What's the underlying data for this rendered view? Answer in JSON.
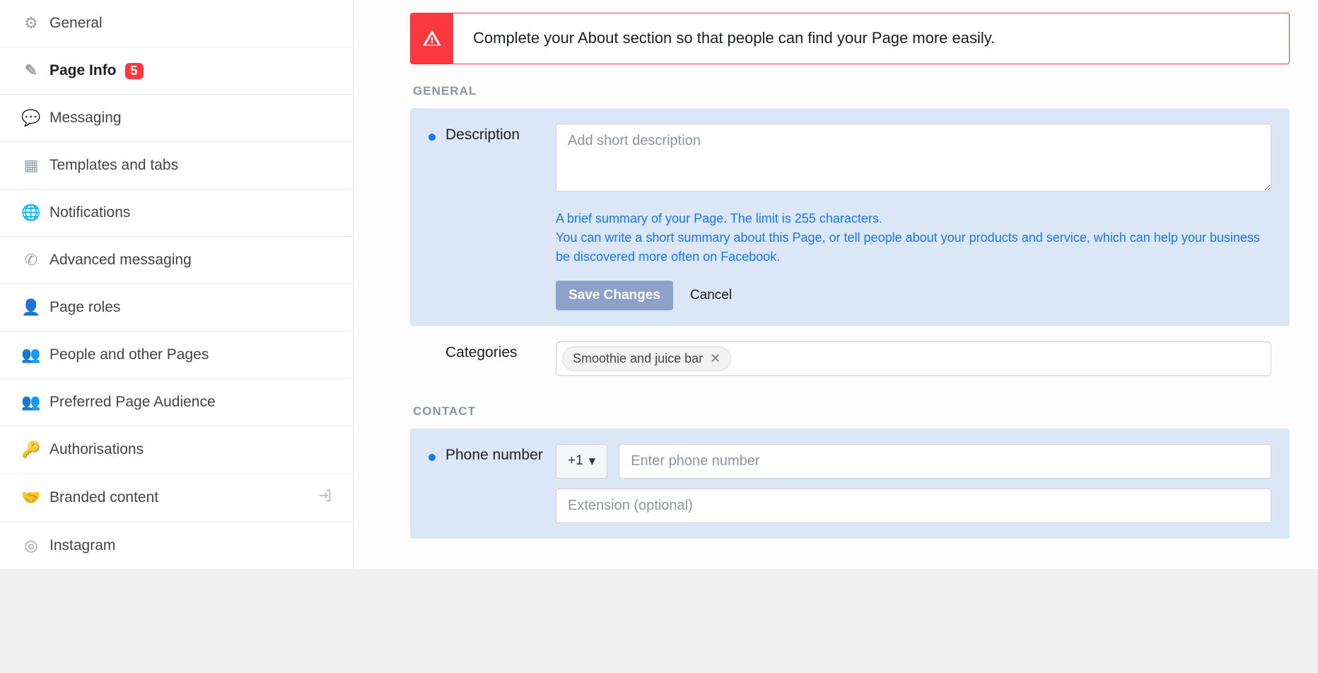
{
  "sidebar": {
    "items": [
      {
        "label": "General",
        "icon": "⚙"
      },
      {
        "label": "Page Info",
        "icon": "✎",
        "badge": "5",
        "active": true
      },
      {
        "label": "Messaging",
        "icon": "💬"
      },
      {
        "label": "Templates and tabs",
        "icon": "▦"
      },
      {
        "label": "Notifications",
        "icon": "🌐"
      },
      {
        "label": "Advanced messaging",
        "icon": "✆"
      },
      {
        "label": "Page roles",
        "icon": "👤"
      },
      {
        "label": "People and other Pages",
        "icon": "👥"
      },
      {
        "label": "Preferred Page Audience",
        "icon": "👥"
      },
      {
        "label": "Authorisations",
        "icon": "🔑"
      },
      {
        "label": "Branded content",
        "icon": "🤝",
        "trailing": true
      },
      {
        "label": "Instagram",
        "icon": "◎"
      }
    ]
  },
  "alert": {
    "text": "Complete your About section so that people can find your Page more easily."
  },
  "sections": {
    "general_header": "GENERAL",
    "contact_header": "CONTACT"
  },
  "description": {
    "label": "Description",
    "placeholder": "Add short description",
    "help": "A brief summary of your Page. The limit is 255 characters.\nYou can write a short summary about this Page, or tell people about your products and service, which can help your business be discovered more often on Facebook.",
    "save_label": "Save Changes",
    "cancel_label": "Cancel"
  },
  "categories": {
    "label": "Categories",
    "tags": [
      "Smoothie and juice bar"
    ]
  },
  "phone": {
    "label": "Phone number",
    "country_code": "+1",
    "placeholder": "Enter phone number",
    "extension_placeholder": "Extension (optional)"
  }
}
